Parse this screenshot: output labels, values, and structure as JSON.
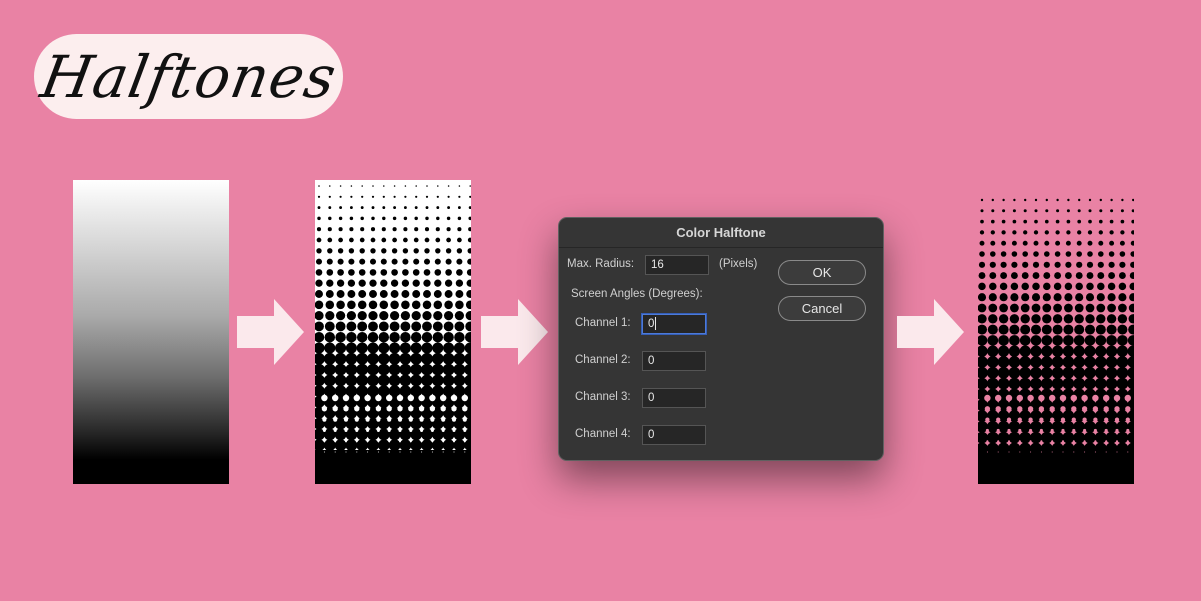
{
  "page": {
    "title": "Halftones",
    "colors": {
      "background": "#e982a4",
      "pill": "#fceeee",
      "arrow": "#fbe9ec",
      "dialog": "#353535"
    }
  },
  "dialog": {
    "title": "Color Halftone",
    "max_radius": {
      "label": "Max. Radius:",
      "value": "16",
      "unit": "(Pixels)"
    },
    "screen_angles_label": "Screen Angles (Degrees):",
    "channels": [
      {
        "label": "Channel 1:",
        "value": "0"
      },
      {
        "label": "Channel 2:",
        "value": "0"
      },
      {
        "label": "Channel 3:",
        "value": "0"
      },
      {
        "label": "Channel 4:",
        "value": "0"
      }
    ],
    "ok_label": "OK",
    "cancel_label": "Cancel"
  },
  "icons": [
    "arrow-right-icon"
  ]
}
